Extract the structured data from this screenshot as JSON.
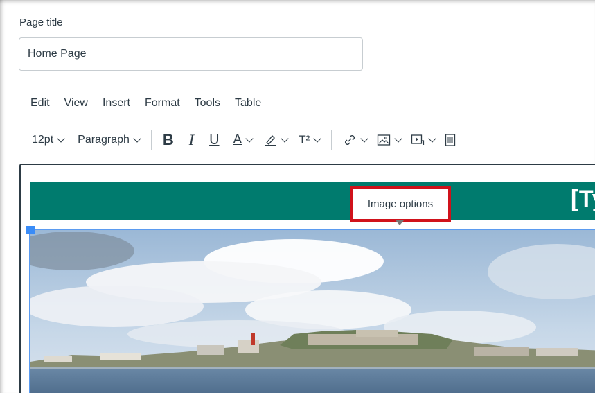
{
  "form": {
    "page_title_label": "Page title",
    "page_title_value": "Home Page"
  },
  "menubar": {
    "items": [
      "Edit",
      "View",
      "Insert",
      "Format",
      "Tools",
      "Table"
    ]
  },
  "toolbar": {
    "font_size": "12pt",
    "block_format": "Paragraph",
    "bold": "B",
    "italic": "I",
    "underline": "U",
    "text_color": "A",
    "superscript": "T²"
  },
  "content": {
    "banner_text": "[Ty",
    "banner_color": "#007b6e"
  },
  "tooltip": {
    "label": "Image options",
    "highlight_color": "#d0121b"
  }
}
